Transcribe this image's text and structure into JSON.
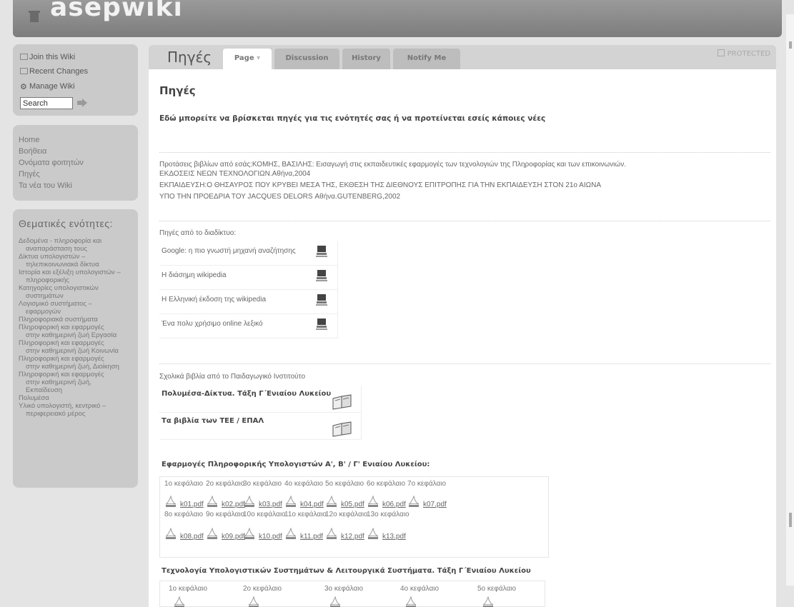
{
  "header": {
    "site_name": "asepwiki"
  },
  "toolbox": {
    "join": "Join this Wiki",
    "recent": "Recent Changes",
    "manage": "Manage Wiki",
    "search_value": "Search"
  },
  "nav": [
    "Home",
    "Βοήθεια",
    "Ονόματα φοιτητών",
    "Πηγές",
    "Τα νέα του Wiki"
  ],
  "thematic": {
    "title": "Θεματικές ενότητες:",
    "items": [
      [
        "Δεδομένα - πληροφορία και",
        "αναπαράσταση τους"
      ],
      [
        "Δίκτυα υπολογιστών –",
        "τηλεπικοινωνιακά δίκτυα"
      ],
      [
        "Ιστορία και εξέλιξη υπολογιστών –",
        "πληροφορικής"
      ],
      [
        "Κατηγορίες υπολογιστικών",
        "συστημάτων"
      ],
      [
        "Λογισμικό συστήματος –",
        "εφαρμογών"
      ],
      [
        "Πληροφοριακά συστήματα"
      ],
      [
        "Πληροφορική και εφαρμογές",
        "στην καθημερινή ζωή Εργασία"
      ],
      [
        "Πληροφορική και εφαρμογές",
        "στην καθημερινή ζωή Κοινωνία"
      ],
      [
        "Πληροφορική και εφαρμογές",
        "στην καθημερινή ζωή, Διοίκηση"
      ],
      [
        "Πληροφορική και εφαρμογές",
        "στην καθημερινή ζωή,",
        "Εκπαίδευση"
      ],
      [
        "Πολυμέσα"
      ],
      [
        "Υλικό υπολογιστή, κεντρικό –",
        "περιφερειακό μέρος"
      ]
    ]
  },
  "tabs": {
    "page_title": "Πηγές",
    "page": "Page",
    "discussion": "Discussion",
    "history": "History",
    "notify": "Notify Me",
    "protected": "PROTECTED"
  },
  "content": {
    "heading": "Πηγές",
    "intro": "Εδώ μπορείτε να βρίσκεται πηγές για τις ενότητές σας ή να προτείνεται εσείς κάποιες νέες",
    "book_lines": [
      "Προτάσεις βιβλίων από εσάς:ΚΟΜΗΣ, ΒΑΣΙΛΗΣ: Εισαγωγή στις εκπαιδευτικές εφαρμογές των τεχνολογιών της Πληροφορίας και των επικοινωνιών.",
      "ΕΚΔΟΣΕΙΣ ΝΕΩΝ ΤΕΧΝΟΛΟΓΙΩΝ.Αθήνα,2004",
      "ΕΚΠΑΙΔΕΥΣΗ:Ο ΘΗΣΑΥΡΟΣ ΠΟΥ ΚΡΥΒΕΙ ΜΕΣΑ ΤΗΣ, ΕΚΘΕΣΗ ΤΗΣ ΔΙΕΘΝΟΥΣ ΕΠΙΤΡΟΠΗΣ ΓΙΑ ΤΗΝ ΕΚΠΑΙΔΕΥΣΗ ΣΤΟΝ 21ο ΑΙΩΝΑ",
      "ΥΠΟ ΤΗΝ ΠΡΟΕΔΡΙΑ ΤΟΥ JACQUES DELORS Αθήνα.GUTENBERG,2002"
    ],
    "web_title": "Πηγές από το διαδίκτυο:",
    "web_links": [
      "Google: η πιο γνωστή μηχανή αναζήτησης",
      "Η διάσημη wikipedia",
      "Η Ελληνική έκδοση της wikipedia",
      "Ένα πολυ χρήσιμο online λεξικό"
    ],
    "school_title": "Σχολικά βιβλία από το Παιδαγωγικό Ινστιτούτο",
    "school_books": [
      "Πολυμέσα-Δίκτυα. Τάξη Γ΄Ενιαίου Λυκείου",
      "Τα βιβλία των ΤΕΕ / ΕΠΑΛ"
    ],
    "apps_title": "Εφαρμογές Πληροφορικής Υπολογιστών Α', Β' / Γ' Ενιαίου Λυκείου:",
    "chapters_row1": [
      "1ο κεφάλαιο",
      "2ο κεφάλαιο",
      "3ο κεφάλαιο",
      "4ο κεφάλαιο",
      "5ο κεφάλαιο",
      "6ο κεφάλαιο",
      "7ο κεφάλαιο"
    ],
    "pdfs_row1": [
      "k01.pdf",
      "k02.pdf",
      "k03.pdf",
      "k04.pdf",
      "k05.pdf",
      "k06.pdf",
      "k07.pdf"
    ],
    "chapters_row2": [
      "8ο κεφάλαιο",
      "9ο κεφάλαιο",
      "10ο κεφάλαιο",
      "11ο κεφάλαιο",
      "12ο κεφάλαιο",
      "13ο κεφάλαιο"
    ],
    "pdfs_row2": [
      "k08.pdf",
      "k09.pdf",
      "k10.pdf",
      "k11.pdf",
      "k12.pdf",
      "k13.pdf"
    ],
    "tech_title": "Τεχνολογία Υπολογιστικών Συστημάτων & Λειτουργικά Συστήματα. Τάξη Γ΄Ενιαίου Λυκείου",
    "tech_chapters": [
      "1ο κεφάλαιο",
      "2ο κεφάλαιο",
      "3ο κεφάλαιο",
      "4ο κεφάλαιο",
      "5ο κεφάλαιο"
    ]
  }
}
